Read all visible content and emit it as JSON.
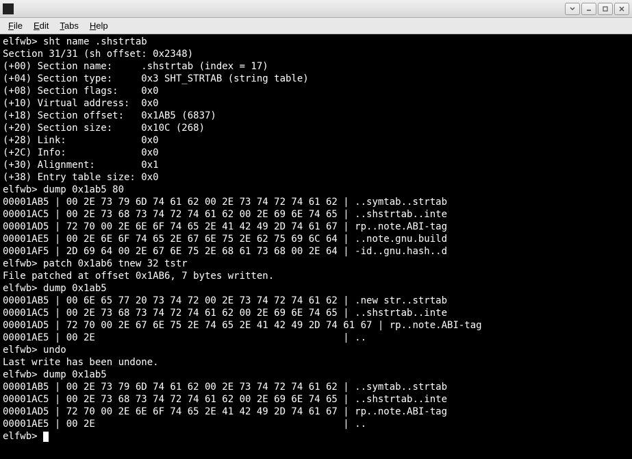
{
  "window": {
    "title": ""
  },
  "menu": {
    "file": "File",
    "edit": "Edit",
    "tabs": "Tabs",
    "help": "Help"
  },
  "terminal": {
    "lines": [
      "elfwb> sht name .shstrtab",
      "Section 31/31 (sh offset: 0x2348)",
      "",
      "(+00) Section name:     .shstrtab (index = 17)",
      "(+04) Section type:     0x3 SHT_STRTAB (string table)",
      "(+08) Section flags:    0x0",
      "(+10) Virtual address:  0x0",
      "(+18) Section offset:   0x1AB5 (6837)",
      "(+20) Section size:     0x10C (268)",
      "(+28) Link:             0x0",
      "(+2C) Info:             0x0",
      "(+30) Alignment:        0x1",
      "(+38) Entry table size: 0x0",
      "elfwb> dump 0x1ab5 80",
      "00001AB5 | 00 2E 73 79 6D 74 61 62 00 2E 73 74 72 74 61 62 | ..symtab..strtab",
      "00001AC5 | 00 2E 73 68 73 74 72 74 61 62 00 2E 69 6E 74 65 | ..shstrtab..inte",
      "00001AD5 | 72 70 00 2E 6E 6F 74 65 2E 41 42 49 2D 74 61 67 | rp..note.ABI-tag",
      "00001AE5 | 00 2E 6E 6F 74 65 2E 67 6E 75 2E 62 75 69 6C 64 | ..note.gnu.build",
      "00001AF5 | 2D 69 64 00 2E 67 6E 75 2E 68 61 73 68 00 2E 64 | -id..gnu.hash..d",
      "elfwb> patch 0x1ab6 tnew 32 tstr",
      "File patched at offset 0x1AB6, 7 bytes written.",
      "elfwb> dump 0x1ab5",
      "00001AB5 | 00 6E 65 77 20 73 74 72 00 2E 73 74 72 74 61 62 | .new str..strtab",
      "00001AC5 | 00 2E 73 68 73 74 72 74 61 62 00 2E 69 6E 74 65 | ..shstrtab..inte",
      "00001AD5 | 72 70 00 2E 67 6E 75 2E 74 65 2E 41 42 49 2D 74 61 67 | rp..note.ABI-tag",
      "00001AE5 | 00 2E                                           | ..",
      "elfwb> undo",
      "Last write has been undone.",
      "elfwb> dump 0x1ab5",
      "00001AB5 | 00 2E 73 79 6D 74 61 62 00 2E 73 74 72 74 61 62 | ..symtab..strtab",
      "00001AC5 | 00 2E 73 68 73 74 72 74 61 62 00 2E 69 6E 74 65 | ..shstrtab..inte",
      "00001AD5 | 72 70 00 2E 6E 6F 74 65 2E 41 42 49 2D 74 61 67 | rp..note.ABI-tag",
      "00001AE5 | 00 2E                                           | .."
    ],
    "prompt": "elfwb> "
  }
}
